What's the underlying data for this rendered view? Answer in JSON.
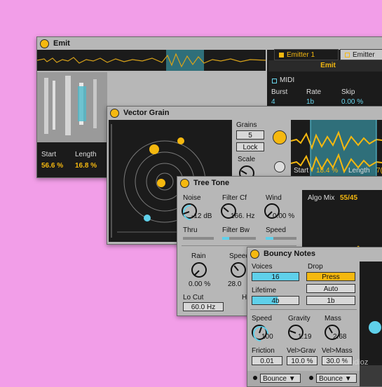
{
  "emit": {
    "title": "Emit",
    "emitter_tabs": [
      "Emitter 1",
      "Emitter"
    ],
    "mode": "Emit",
    "midi_label": "MIDI",
    "params": [
      {
        "label": "Burst",
        "value": "4"
      },
      {
        "label": "Rate",
        "value": "1b"
      },
      {
        "label": "Skip",
        "value": "0.00 %"
      }
    ],
    "start_label": "Start",
    "start_value": "56.6 %",
    "length_label": "Length",
    "length_value": "16.8 %"
  },
  "vector_grain": {
    "title": "Vector Grain",
    "grains_label": "Grains",
    "grains_value": "5",
    "lock_label": "Lock",
    "scale_label": "Scale",
    "start_label": "Start",
    "start_value": "18.4 %",
    "length_label": "Length",
    "length_value": "7("
  },
  "tree_tone": {
    "title": "Tree Tone",
    "noise_label": "Noise",
    "noise_value": "-12 dB",
    "filter_cf_label": "Filter Cf",
    "filter_cf_value": "166. Hz",
    "wind_label": "Wind",
    "wind_value": "0.00 %",
    "thru_label": "Thru",
    "filter_bw_label": "Filter Bw",
    "speed_label": "Speed",
    "rain_label": "Rain",
    "rain_value": "0.00 %",
    "speed2_label": "Speed",
    "speed2_value": "28.0",
    "locut_label": "Lo Cut",
    "locut_value": "60.0 Hz",
    "algo_mix_label": "Algo Mix",
    "algo_mix_value": "55/45"
  },
  "bouncy_notes": {
    "title": "Bouncy Notes",
    "voices_label": "Voices",
    "voices_value": "16",
    "lifetime_label": "Lifetime",
    "lifetime_value": "4b",
    "drop_label": "Drop",
    "press_label": "Press",
    "auto_label": "Auto",
    "drop_rate": "1b",
    "speed_label": "Speed",
    "speed_value": "100",
    "gravity_label": "Gravity",
    "gravity_value": "1.19",
    "mass_label": "Mass",
    "mass_value": "2.68",
    "friction_label": "Friction",
    "friction_value": "0.01",
    "velgrav_label": "Vel>Grav",
    "velgrav_value": "10.0 %",
    "velmass_label": "Vel>Mass",
    "velmass_value": "30.0 %",
    "mode_left": "Bounce",
    "mode_right": "Bounce"
  },
  "watermark": "audioz",
  "colors": {
    "accent": "#f5b80f",
    "cyan": "#5fd0ea",
    "panel": "#b7b7b7",
    "dark": "#1b1b1b",
    "background": "#f29ee8"
  }
}
